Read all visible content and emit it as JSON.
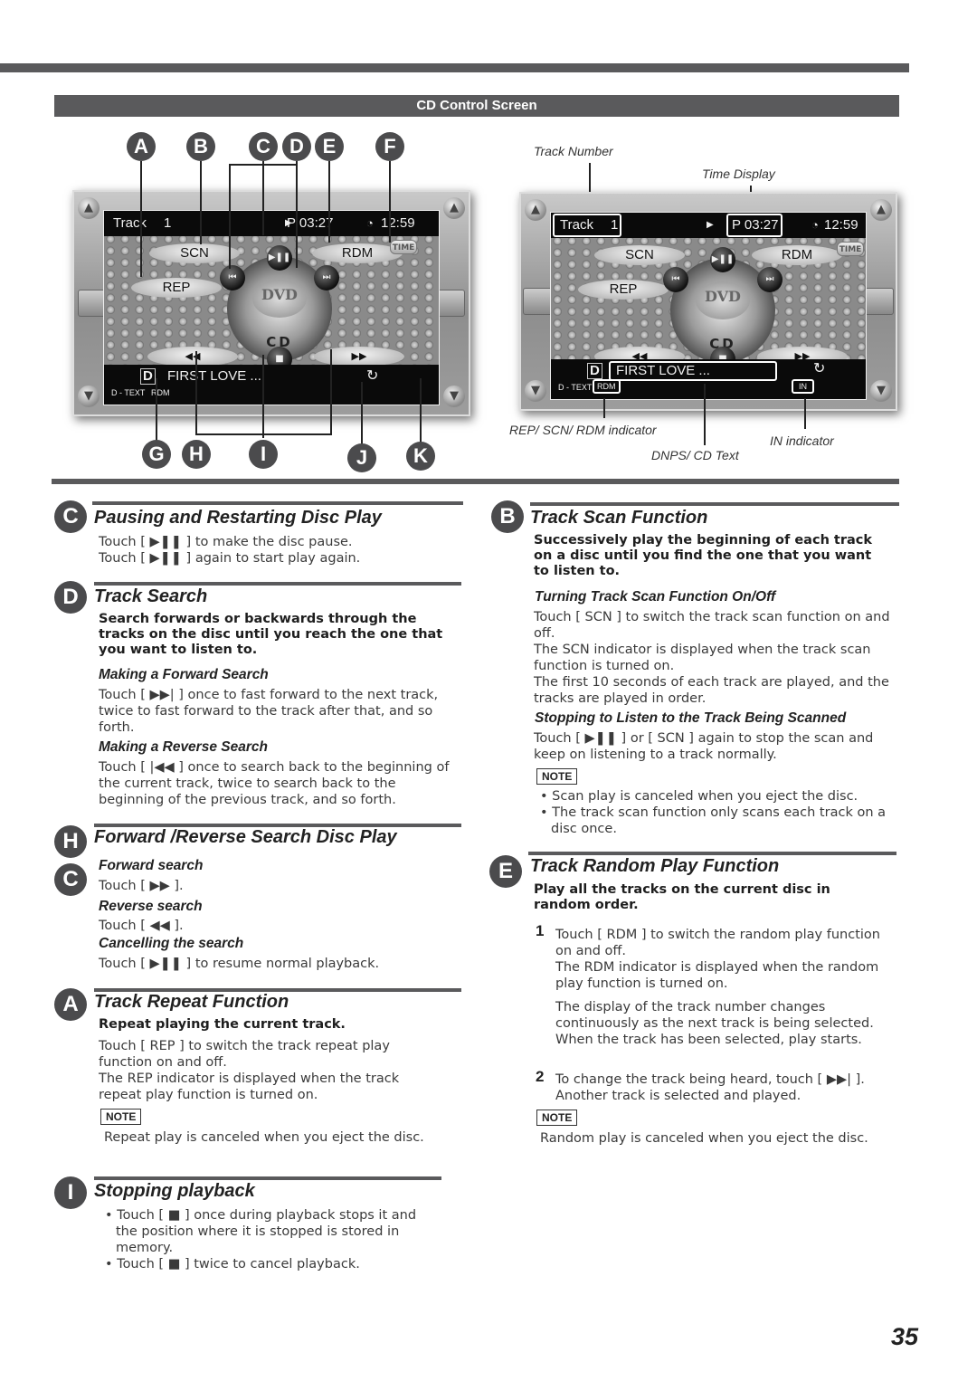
{
  "header": {
    "section_title": "CD Control Screen"
  },
  "screen": {
    "track_label": "Track",
    "track_number": "1",
    "play_time": "P 03:27",
    "clock": "12:59",
    "buttons": {
      "scn": "SCN",
      "rdm": "RDM",
      "rep": "REP",
      "time": "TIME",
      "dvd": "DVD",
      "cd": "CD"
    },
    "glyphs": {
      "play_pause": "▶❚❚",
      "prev": "⏮",
      "next": "⏭",
      "rew": "◀◀",
      "ff": "▶▶",
      "stop": "■",
      "play": "▶",
      "repeat": "↻",
      "clock": "◔",
      "up": "▲",
      "down": "▼"
    },
    "cd_text": "FIRST LOVE ...",
    "d_text_label": "D - TEXT",
    "d_icon": "D",
    "mode_indicator": "RDM",
    "in_indicator": "IN"
  },
  "callouts": {
    "top": [
      "A",
      "B",
      "C",
      "D",
      "E",
      "F"
    ],
    "bottom": [
      "G",
      "H",
      "I",
      "J",
      "K"
    ]
  },
  "annotations": {
    "track_number": "Track Number",
    "time_display": "Time Display",
    "mode_indicator": "REP/ SCN/ RDM indicator",
    "cd_text": "DNPS/ CD Text",
    "in_indicator": "IN indicator"
  },
  "sections": {
    "pause": {
      "badge": "C",
      "title": "Pausing and Restarting Disc Play",
      "lines": [
        "Touch [ ▶❚❚ ] to make the disc pause.",
        "Touch [ ▶❚❚ ] again to start play again."
      ]
    },
    "track_search": {
      "badge": "D",
      "title": "Track Search",
      "lead": "Search forwards or backwards through the tracks on the disc until you reach the one that you want to listen to.",
      "forward_title": "Making a Forward Search",
      "forward_text": "Touch [ ▶▶| ] once to fast forward to the next track, twice to fast forward to the track after that, and so forth.",
      "reverse_title": "Making a Reverse Search",
      "reverse_text": "Touch [ |◀◀ ] once to search back to the beginning of the current track, twice to search back to the beginning of the previous track, and so forth."
    },
    "fr_search": {
      "badges": [
        "H",
        "C"
      ],
      "title": "Forward /Reverse Search Disc Play",
      "forward_title": "Forward search",
      "forward_text": "Touch [ ▶▶ ].",
      "reverse_title": "Reverse search",
      "reverse_text": "Touch [ ◀◀ ].",
      "cancel_title": "Cancelling the search",
      "cancel_text": "Touch [ ▶❚❚ ] to resume normal playback."
    },
    "repeat": {
      "badge": "A",
      "title": "Track Repeat Function",
      "lead": "Repeat playing the current track.",
      "text": "Touch [ REP ] to switch the track repeat play function on and off.\nThe REP indicator is displayed when the track repeat play function is turned on.",
      "note_label": "NOTE",
      "note": "Repeat play is canceled when you eject the disc."
    },
    "stop": {
      "badge": "I",
      "title": "Stopping playback",
      "bullets": [
        "Touch [ ■ ] once during playback stops it and the position where it is stopped is stored in memory.",
        "Touch [ ■ ] twice to cancel playback."
      ]
    },
    "scan": {
      "badge": "B",
      "title": "Track Scan Function",
      "lead": "Successively play the beginning of each track on a disc until you find the one that you want to listen to.",
      "onoff_title": "Turning Track Scan Function On/Off",
      "onoff_text": "Touch [ SCN ] to switch the track scan function on and off.\nThe SCN indicator is displayed when the track scan function is turned on.\nThe first 10 seconds of each track are played, and the tracks are played in order.",
      "stop_title": "Stopping to Listen to the Track Being Scanned",
      "stop_text": "Touch [ ▶❚❚ ] or [ SCN ] again to stop the scan and keep on listening to a track normally.",
      "note_label": "NOTE",
      "notes": [
        "Scan play is canceled when you eject the disc.",
        "The track scan function only scans each track on a disc once."
      ]
    },
    "random": {
      "badge": "E",
      "title": "Track Random Play Function",
      "lead": "Play all the tracks on the current disc in random order.",
      "steps": [
        {
          "num": "1",
          "text": "Touch [ RDM ] to switch the random play function on and off.\nThe RDM indicator is displayed when the random  play function is turned on.",
          "extra": "The display of the track number changes continuously as the next track is being selected.\nWhen the track has been selected, play starts."
        },
        {
          "num": "2",
          "text": "To change the track being heard, touch [ ▶▶| ].\nAnother track is selected and played."
        }
      ],
      "note_label": "NOTE",
      "note": "Random play is canceled when you eject the disc."
    }
  },
  "page_number": "35"
}
